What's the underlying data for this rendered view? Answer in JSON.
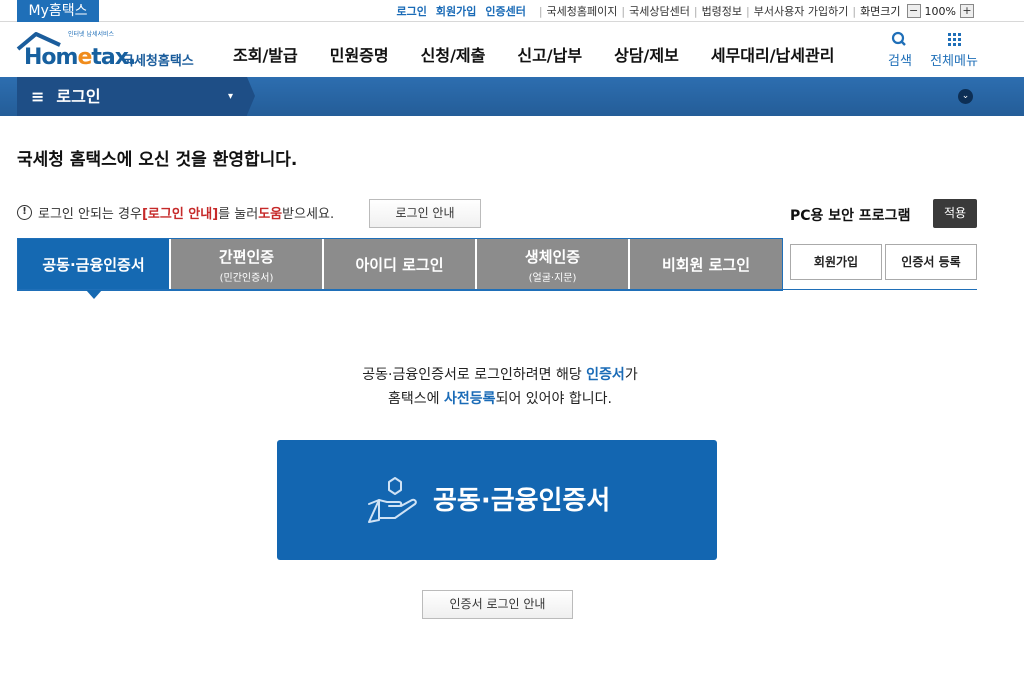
{
  "topbar": {
    "my_hometax": "My홈택스",
    "links_blue": [
      "로그인",
      "회원가입",
      "인증센터"
    ],
    "links": [
      "국세청홈페이지",
      "국세상담센터",
      "법령정보",
      "부서사용자 가입하기"
    ],
    "zoom_label": "화면크기",
    "zoom_minus": "−",
    "zoom_value": "100%",
    "zoom_plus": "+"
  },
  "header": {
    "logo_small": "인터넷 납세서비스",
    "logo_brand_pre": "Hom",
    "logo_brand_e": "e",
    "logo_brand_post": "tax.",
    "logo_ko": "국세청홈택스",
    "nav": [
      "조회/발급",
      "민원증명",
      "신청/제출",
      "신고/납부",
      "상담/제보",
      "세무대리/납세관리"
    ],
    "search_label": "검색",
    "menu_label": "전체메뉴"
  },
  "loginbar": {
    "title": "로그인",
    "caret": "▾",
    "expand": "⌄"
  },
  "welcome": "국세청 홈택스에 오신 것을 환영합니다.",
  "notice": {
    "pre": "로그인 안되는 경우 ",
    "red1": "[로그인 안내]",
    "mid": "를 눌러 ",
    "red2": "도움",
    "post": "받으세요.",
    "guide_button": "로그인 안내"
  },
  "pc_security": {
    "label": "PC용 보안 프로그램",
    "apply_button": "적용"
  },
  "tabs": [
    {
      "main": "공동·금융인증서",
      "sub": ""
    },
    {
      "main": "간편인증",
      "sub": "(민간인증서)"
    },
    {
      "main": "아이디 로그인",
      "sub": ""
    },
    {
      "main": "생체인증",
      "sub": "(얼굴·지문)"
    },
    {
      "main": "비회원 로그인",
      "sub": ""
    }
  ],
  "side_buttons": {
    "signup": "회원가입",
    "cert_register": "인증서 등록"
  },
  "description": {
    "line1_pre": "공동·금융인증서로 로그인하려면 해당 ",
    "line1_hl": "인증서",
    "line1_post": "가",
    "line2_pre": "홈택스에 ",
    "line2_hl": "사전등록",
    "line2_post": "되어 있어야 합니다."
  },
  "main_button": "공동·금융인증서",
  "cert_guide_button": "인증서 로그인 안내",
  "colors": {
    "primary": "#1366b1",
    "nav_dark": "#1e4e86",
    "tab_inactive": "#8c8c8c",
    "highlight_red": "#c62a2a"
  }
}
